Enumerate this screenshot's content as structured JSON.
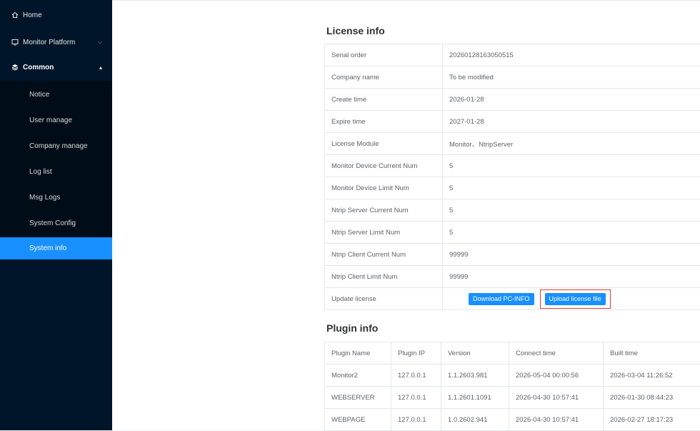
{
  "sidebar": {
    "top_items": [
      {
        "label": "Home",
        "icon": "home-icon"
      },
      {
        "label": "Monitor Platform",
        "icon": "monitor-icon"
      },
      {
        "label": "Common",
        "icon": "layers-icon"
      }
    ],
    "sub_items": [
      {
        "label": "Notice"
      },
      {
        "label": "User manage"
      },
      {
        "label": "Company manage"
      },
      {
        "label": "Log list"
      },
      {
        "label": "Msg Logs"
      },
      {
        "label": "System Config"
      },
      {
        "label": "System info",
        "active": true
      }
    ]
  },
  "license": {
    "title": "License info",
    "rows": [
      {
        "label": "Serial order",
        "value": "20260128163050515"
      },
      {
        "label": "Company name",
        "value": "To be modified"
      },
      {
        "label": "Create time",
        "value": "2026-01-28"
      },
      {
        "label": "Expire time",
        "value": "2027-01-28"
      },
      {
        "label": "License Module",
        "value": "Monitor、NtripServer"
      },
      {
        "label": "Monitor Device Current Num",
        "value": "5"
      },
      {
        "label": "Monitor Device Limit Num",
        "value": "5"
      },
      {
        "label": "Ntrip Server Current Num",
        "value": "5"
      },
      {
        "label": "Ntrip Server Limit Num",
        "value": "5"
      },
      {
        "label": "Ntrip Client Current Num",
        "value": "99999"
      },
      {
        "label": "Ntrip Client Limit Num",
        "value": "99999"
      }
    ],
    "update_label": "Update license",
    "download_button": "Download PC-INFO",
    "upload_button": "Upload license file"
  },
  "plugin": {
    "title": "Plugin info",
    "headers": [
      "Plugin Name",
      "Plugin IP",
      "Version",
      "Connect time",
      "Built time"
    ],
    "rows": [
      [
        "Monitor2",
        "127.0.0.1",
        "1.1.2603.981",
        "2026-05-04 00:00:56",
        "2026-03-04 11:26:52"
      ],
      [
        "WEBSERVER",
        "127.0.0.1",
        "1.1.2601.1091",
        "2026-04-30 10:57:41",
        "2026-01-30 08:44:23"
      ],
      [
        "WEBPAGE",
        "127.0.0.1",
        "1.0.2602.941",
        "2026-04-30 10:57:41",
        "2026-02-27 18:17:23"
      ]
    ]
  },
  "colors": {
    "sidebar_bg": "#001529",
    "submenu_bg": "#000c17",
    "active": "#1890ff",
    "highlight_box": "#e53935"
  }
}
